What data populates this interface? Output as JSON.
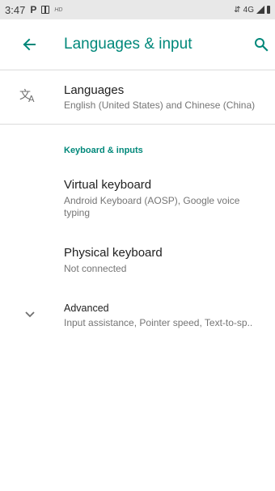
{
  "status_bar": {
    "time": "3:47",
    "network": "4G"
  },
  "app_bar": {
    "title": "Languages & input"
  },
  "rows": {
    "languages": {
      "title": "Languages",
      "subtitle": "English (United States) and Chinese (China)"
    },
    "section_header": "Keyboard & inputs",
    "virtual_keyboard": {
      "title": "Virtual keyboard",
      "subtitle": "Android Keyboard (AOSP), Google voice typing"
    },
    "physical_keyboard": {
      "title": "Physical keyboard",
      "subtitle": "Not connected"
    },
    "advanced": {
      "title": "Advanced",
      "subtitle": "Input assistance, Pointer speed, Text-to-sp.."
    }
  },
  "colors": {
    "accent": "#00887a",
    "status_bar_bg": "#e8e8e8"
  }
}
